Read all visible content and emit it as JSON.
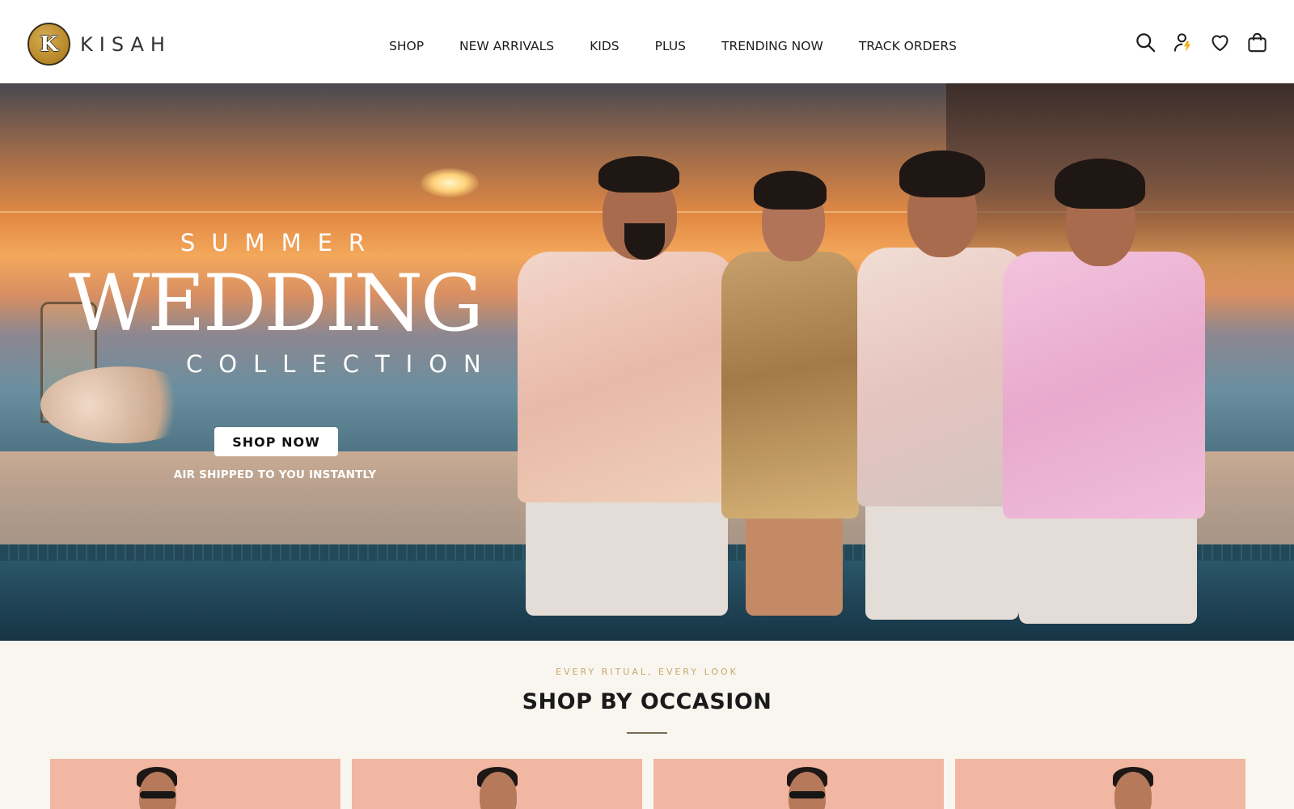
{
  "brand": {
    "name": "KISAH",
    "mark": "K"
  },
  "nav": {
    "items": [
      {
        "label": "SHOP"
      },
      {
        "label": "NEW ARRIVALS"
      },
      {
        "label": "KIDS"
      },
      {
        "label": "PLUS"
      },
      {
        "label": "TRENDING NOW"
      },
      {
        "label": "TRACK ORDERS"
      }
    ]
  },
  "header_icons": [
    "search-icon",
    "account-icon",
    "wishlist-heart-icon",
    "shopping-bag-icon"
  ],
  "hero": {
    "eyebrow": "SUMMER",
    "title": "WEDDING",
    "subtitle": "COLLECTION",
    "cta_label": "SHOP NOW",
    "note": "AIR SHIPPED TO YOU INSTANTLY"
  },
  "occasion": {
    "eyebrow": "EVERY RITUAL, EVERY LOOK",
    "title": "SHOP BY OCCASION",
    "cards": [
      {
        "image": "occasion-card-1"
      },
      {
        "image": "occasion-card-2"
      },
      {
        "image": "occasion-card-3"
      },
      {
        "image": "occasion-card-4"
      }
    ]
  },
  "colors": {
    "brand_gold": "#c29a3e",
    "section_bg": "#f9f6f0",
    "eyebrow_gold": "#c7a86a",
    "card_bg": "#f1b7a3"
  }
}
